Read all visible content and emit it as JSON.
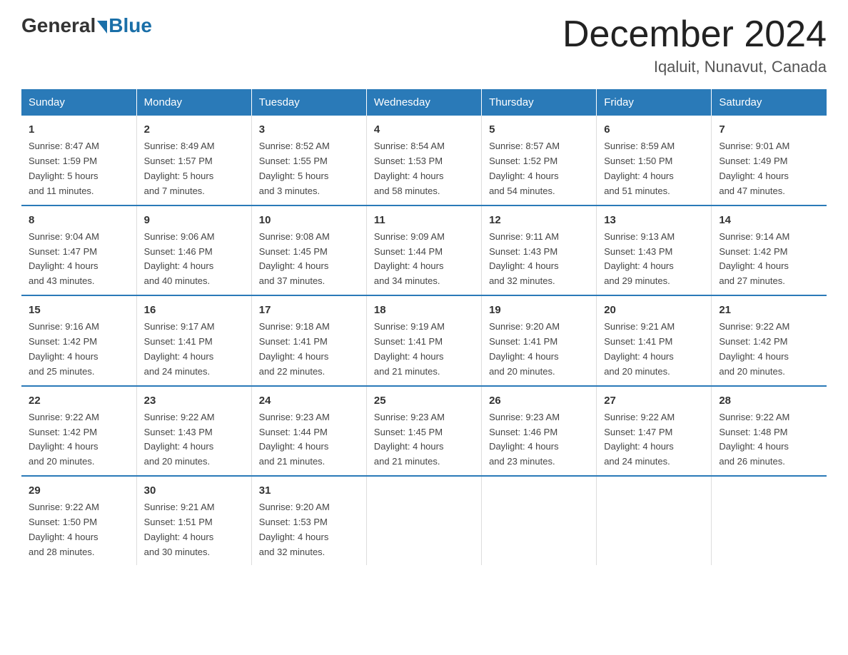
{
  "header": {
    "logo": {
      "general": "General",
      "blue": "Blue"
    },
    "title": "December 2024",
    "subtitle": "Iqaluit, Nunavut, Canada"
  },
  "columns": [
    "Sunday",
    "Monday",
    "Tuesday",
    "Wednesday",
    "Thursday",
    "Friday",
    "Saturday"
  ],
  "weeks": [
    [
      {
        "day": "1",
        "info": "Sunrise: 8:47 AM\nSunset: 1:59 PM\nDaylight: 5 hours\nand 11 minutes."
      },
      {
        "day": "2",
        "info": "Sunrise: 8:49 AM\nSunset: 1:57 PM\nDaylight: 5 hours\nand 7 minutes."
      },
      {
        "day": "3",
        "info": "Sunrise: 8:52 AM\nSunset: 1:55 PM\nDaylight: 5 hours\nand 3 minutes."
      },
      {
        "day": "4",
        "info": "Sunrise: 8:54 AM\nSunset: 1:53 PM\nDaylight: 4 hours\nand 58 minutes."
      },
      {
        "day": "5",
        "info": "Sunrise: 8:57 AM\nSunset: 1:52 PM\nDaylight: 4 hours\nand 54 minutes."
      },
      {
        "day": "6",
        "info": "Sunrise: 8:59 AM\nSunset: 1:50 PM\nDaylight: 4 hours\nand 51 minutes."
      },
      {
        "day": "7",
        "info": "Sunrise: 9:01 AM\nSunset: 1:49 PM\nDaylight: 4 hours\nand 47 minutes."
      }
    ],
    [
      {
        "day": "8",
        "info": "Sunrise: 9:04 AM\nSunset: 1:47 PM\nDaylight: 4 hours\nand 43 minutes."
      },
      {
        "day": "9",
        "info": "Sunrise: 9:06 AM\nSunset: 1:46 PM\nDaylight: 4 hours\nand 40 minutes."
      },
      {
        "day": "10",
        "info": "Sunrise: 9:08 AM\nSunset: 1:45 PM\nDaylight: 4 hours\nand 37 minutes."
      },
      {
        "day": "11",
        "info": "Sunrise: 9:09 AM\nSunset: 1:44 PM\nDaylight: 4 hours\nand 34 minutes."
      },
      {
        "day": "12",
        "info": "Sunrise: 9:11 AM\nSunset: 1:43 PM\nDaylight: 4 hours\nand 32 minutes."
      },
      {
        "day": "13",
        "info": "Sunrise: 9:13 AM\nSunset: 1:43 PM\nDaylight: 4 hours\nand 29 minutes."
      },
      {
        "day": "14",
        "info": "Sunrise: 9:14 AM\nSunset: 1:42 PM\nDaylight: 4 hours\nand 27 minutes."
      }
    ],
    [
      {
        "day": "15",
        "info": "Sunrise: 9:16 AM\nSunset: 1:42 PM\nDaylight: 4 hours\nand 25 minutes."
      },
      {
        "day": "16",
        "info": "Sunrise: 9:17 AM\nSunset: 1:41 PM\nDaylight: 4 hours\nand 24 minutes."
      },
      {
        "day": "17",
        "info": "Sunrise: 9:18 AM\nSunset: 1:41 PM\nDaylight: 4 hours\nand 22 minutes."
      },
      {
        "day": "18",
        "info": "Sunrise: 9:19 AM\nSunset: 1:41 PM\nDaylight: 4 hours\nand 21 minutes."
      },
      {
        "day": "19",
        "info": "Sunrise: 9:20 AM\nSunset: 1:41 PM\nDaylight: 4 hours\nand 20 minutes."
      },
      {
        "day": "20",
        "info": "Sunrise: 9:21 AM\nSunset: 1:41 PM\nDaylight: 4 hours\nand 20 minutes."
      },
      {
        "day": "21",
        "info": "Sunrise: 9:22 AM\nSunset: 1:42 PM\nDaylight: 4 hours\nand 20 minutes."
      }
    ],
    [
      {
        "day": "22",
        "info": "Sunrise: 9:22 AM\nSunset: 1:42 PM\nDaylight: 4 hours\nand 20 minutes."
      },
      {
        "day": "23",
        "info": "Sunrise: 9:22 AM\nSunset: 1:43 PM\nDaylight: 4 hours\nand 20 minutes."
      },
      {
        "day": "24",
        "info": "Sunrise: 9:23 AM\nSunset: 1:44 PM\nDaylight: 4 hours\nand 21 minutes."
      },
      {
        "day": "25",
        "info": "Sunrise: 9:23 AM\nSunset: 1:45 PM\nDaylight: 4 hours\nand 21 minutes."
      },
      {
        "day": "26",
        "info": "Sunrise: 9:23 AM\nSunset: 1:46 PM\nDaylight: 4 hours\nand 23 minutes."
      },
      {
        "day": "27",
        "info": "Sunrise: 9:22 AM\nSunset: 1:47 PM\nDaylight: 4 hours\nand 24 minutes."
      },
      {
        "day": "28",
        "info": "Sunrise: 9:22 AM\nSunset: 1:48 PM\nDaylight: 4 hours\nand 26 minutes."
      }
    ],
    [
      {
        "day": "29",
        "info": "Sunrise: 9:22 AM\nSunset: 1:50 PM\nDaylight: 4 hours\nand 28 minutes."
      },
      {
        "day": "30",
        "info": "Sunrise: 9:21 AM\nSunset: 1:51 PM\nDaylight: 4 hours\nand 30 minutes."
      },
      {
        "day": "31",
        "info": "Sunrise: 9:20 AM\nSunset: 1:53 PM\nDaylight: 4 hours\nand 32 minutes."
      },
      null,
      null,
      null,
      null
    ]
  ]
}
